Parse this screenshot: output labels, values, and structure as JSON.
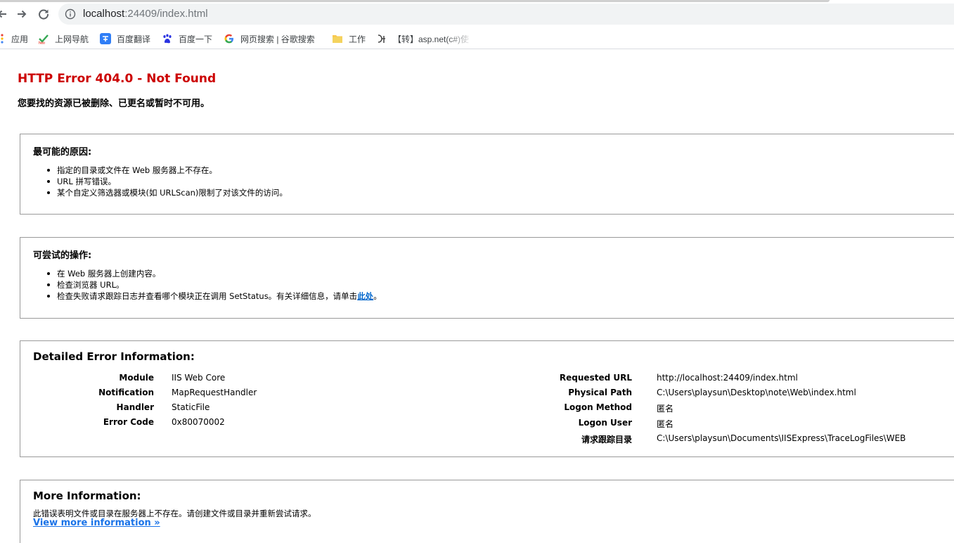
{
  "browser": {
    "url_host": "localhost",
    "url_path": ":24409/index.html",
    "bookmarks": [
      {
        "label": "应用",
        "icon": "apps-grid-icon"
      },
      {
        "label": "上网导航",
        "icon": "hao123-icon"
      },
      {
        "label": "百度翻译",
        "icon": "translate-icon"
      },
      {
        "label": "百度一下",
        "icon": "baidu-paw-icon"
      },
      {
        "label": "网页搜索 | 谷歌搜索",
        "icon": "google-g-icon"
      },
      {
        "label": "工作",
        "icon": "folder-icon"
      },
      {
        "label": "【转】asp.net(c#)使",
        "icon": "bookmark-site-icon"
      }
    ]
  },
  "error": {
    "title": "HTTP Error 404.0 - Not Found",
    "subtitle": "您要找的资源已被删除、已更名或暂时不可用。"
  },
  "causes": {
    "heading": "最可能的原因:",
    "items": [
      "指定的目录或文件在 Web 服务器上不存在。",
      "URL 拼写错误。",
      "某个自定义筛选器或模块(如 URLScan)限制了对该文件的访问。"
    ]
  },
  "actions": {
    "heading": "可尝试的操作:",
    "items": [
      "在 Web 服务器上创建内容。",
      "检查浏览器 URL。",
      "检查失败请求跟踪日志并查看哪个模块正在调用 SetStatus。有关详细信息，请单击"
    ],
    "link_text": "此处",
    "link_suffix": "。"
  },
  "details": {
    "heading": "Detailed Error Information:",
    "left": [
      {
        "label": "Module",
        "value": "IIS Web Core"
      },
      {
        "label": "Notification",
        "value": "MapRequestHandler"
      },
      {
        "label": "Handler",
        "value": "StaticFile"
      },
      {
        "label": "Error Code",
        "value": "0x80070002"
      }
    ],
    "right": [
      {
        "label": "Requested URL",
        "value": "http://localhost:24409/index.html"
      },
      {
        "label": "Physical Path",
        "value": "C:\\Users\\playsun\\Desktop\\note\\Web\\index.html"
      },
      {
        "label": "Logon Method",
        "value": "匿名"
      },
      {
        "label": "Logon User",
        "value": "匿名"
      },
      {
        "label": "请求跟踪目录",
        "value": "C:\\Users\\playsun\\Documents\\IISExpress\\TraceLogFiles\\WEB"
      }
    ]
  },
  "more": {
    "heading": "More Information:",
    "text": "此错误表明文件或目录在服务器上不存在。请创建文件或目录并重新尝试请求。",
    "link": "View more information »"
  },
  "colors": {
    "title_red": "#cc0000",
    "link_blue": "#0066cc",
    "border_gray": "#9a9a9a"
  }
}
